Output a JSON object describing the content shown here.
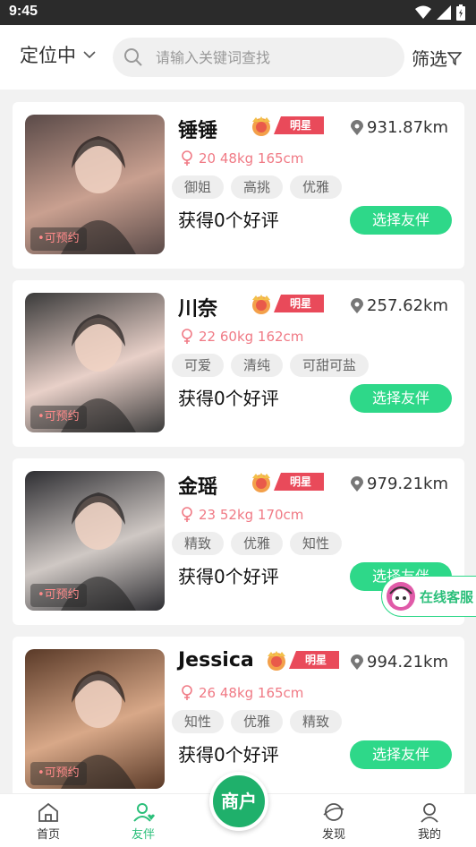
{
  "status": {
    "time": "9:45"
  },
  "topbar": {
    "location_label": "定位中",
    "search_placeholder": "请输入关键词查找",
    "filter_label": "筛选"
  },
  "cards": [
    {
      "name": "锤锤",
      "star_label": "明星",
      "distance": "931.87km",
      "info": "20 48kg 165cm",
      "tags": [
        "御姐",
        "高挑",
        "优雅"
      ],
      "reviews": "获得0个好评",
      "button": "选择友伴",
      "badge": "•可预约",
      "photo_colors": [
        "#5a4a48",
        "#c9a090"
      ]
    },
    {
      "name": "川奈",
      "star_label": "明星",
      "distance": "257.62km",
      "info": "22 60kg 162cm",
      "tags": [
        "可爱",
        "清纯",
        "可甜可盐"
      ],
      "reviews": "获得0个好评",
      "button": "选择友伴",
      "badge": "•可预约",
      "photo_colors": [
        "#3a3a3a",
        "#e8d0c8"
      ]
    },
    {
      "name": "金瑶",
      "star_label": "明星",
      "distance": "979.21km",
      "info": "23 52kg 170cm",
      "tags": [
        "精致",
        "优雅",
        "知性"
      ],
      "reviews": "获得0个好评",
      "button": "选择友伴",
      "badge": "•可预约",
      "photo_colors": [
        "#2e2e32",
        "#cfc8c4"
      ]
    },
    {
      "name": "Jessica",
      "star_label": "明星",
      "distance": "994.21km",
      "info": "26 48kg 165cm",
      "tags": [
        "知性",
        "优雅",
        "精致"
      ],
      "reviews": "获得0个好评",
      "button": "选择友伴",
      "badge": "•可预约",
      "photo_colors": [
        "#5a3a28",
        "#d8a888"
      ]
    }
  ],
  "service": {
    "label": "在线客服"
  },
  "tabbar": {
    "home": "首页",
    "companion": "友伴",
    "merchant": "商户",
    "discover": "发现",
    "mine": "我的"
  },
  "colors": {
    "accent": "#2ed889",
    "star": "#e94a5a",
    "info": "#f07a85"
  }
}
